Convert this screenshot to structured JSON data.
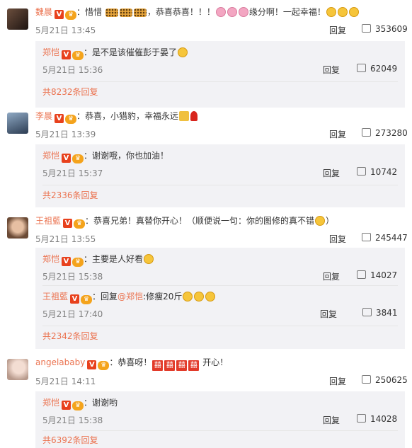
{
  "comments": [
    {
      "user": "魏晨",
      "text_a": "：惜惜",
      "text_b": "，恭喜恭喜！！！",
      "text_c": "缘分啊！一起幸福！",
      "time": "5月21日 13:45",
      "reply_label": "回复",
      "likes": "353609",
      "avatar_color": "#3a2b25",
      "replies": [
        {
          "user": "郑恺",
          "text": "：是不是该催催彭于晏了",
          "time": "5月21日 15:36",
          "reply_label": "回复",
          "likes": "62049"
        }
      ],
      "total": "共8232条回复"
    },
    {
      "user": "李晨",
      "text_a": "：恭喜，小猎豹，幸福永远",
      "time": "5月21日 13:39",
      "reply_label": "回复",
      "likes": "273280",
      "avatar_color": "#4a6a8a",
      "replies": [
        {
          "user": "郑恺",
          "text": "：谢谢哦，你也加油！",
          "time": "5月21日 15:37",
          "reply_label": "回复",
          "likes": "10742"
        }
      ],
      "total": "共2336条回复"
    },
    {
      "user": "王祖藍",
      "text_a": "：恭喜兄弟！真替你开心！（顺便说一句：你的图修的真不错",
      "text_b": "）",
      "time": "5月21日 13:55",
      "reply_label": "回复",
      "likes": "245447",
      "avatar_color": "#c89a7a",
      "replies": [
        {
          "user": "郑恺",
          "text": "：主要是人好看",
          "time": "5月21日 15:38",
          "reply_label": "回复",
          "likes": "14027"
        },
        {
          "user": "王祖藍",
          "text_pre": "：回复",
          "mention": "@郑恺",
          "text": ":修瘦20斤",
          "time": "5月21日 17:40",
          "reply_label": "回复",
          "likes": "3841"
        }
      ],
      "total": "共2342条回复"
    },
    {
      "user": "angelababy",
      "text_a": "：恭喜呀！",
      "text_b": "开心！",
      "time": "5月21日 14:11",
      "reply_label": "回复",
      "likes": "250625",
      "avatar_color": "#d9c7c0",
      "replies": [
        {
          "user": "郑恺",
          "text": "：谢谢哟",
          "time": "5月21日 15:38",
          "reply_label": "回复",
          "likes": "14028"
        }
      ],
      "total": "共6392条回复"
    }
  ],
  "badges": {
    "verified": "V",
    "vip": "♛",
    "double_happiness": "囍"
  },
  "colors": {
    "username": "#eb7350",
    "reply_bg": "#f2f2f5",
    "meta": "#808080"
  }
}
